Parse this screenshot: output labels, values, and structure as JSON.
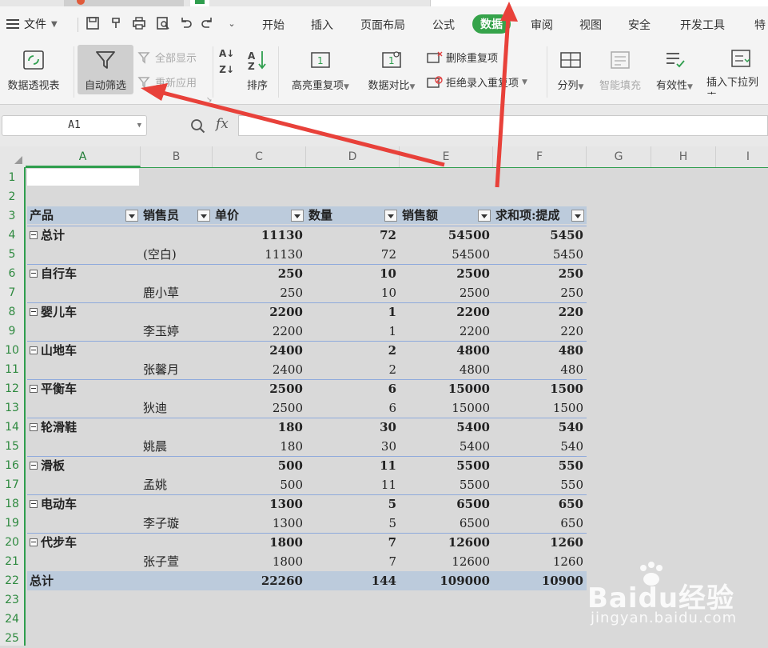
{
  "menu": {
    "file_label": "文件",
    "tabs": [
      "开始",
      "插入",
      "页面布局",
      "公式",
      "数据",
      "审阅",
      "视图",
      "安全",
      "开发工具",
      "特"
    ],
    "active_tab": "数据"
  },
  "ribbon": {
    "pivot": "数据透视表",
    "autofilter": "自动筛选",
    "show_all": "全部显示",
    "reapply": "重新应用",
    "sort": "排序",
    "highlight_dup": "高亮重复项",
    "compare": "数据对比",
    "remove_dup": "删除重复项",
    "reject_dup": "拒绝录入重复项",
    "split": "分列",
    "smart_fill": "智能填充",
    "validity": "有效性",
    "insert_dropdown": "插入下拉列表"
  },
  "formula_bar": {
    "name_box": "A1",
    "fx": "fx",
    "formula": ""
  },
  "columns": [
    "A",
    "B",
    "C",
    "D",
    "E",
    "F",
    "G",
    "H",
    "I"
  ],
  "rows": [
    "1",
    "2",
    "3",
    "4",
    "5",
    "6",
    "7",
    "8",
    "9",
    "10",
    "11",
    "12",
    "13",
    "14",
    "15",
    "16",
    "17",
    "18",
    "19",
    "20",
    "21",
    "22",
    "23",
    "24",
    "25"
  ],
  "pivot": {
    "headers": [
      "产品",
      "销售员",
      "单价",
      "数量",
      "销售额",
      "求和项:提成"
    ],
    "rows": [
      {
        "product": "总计",
        "seller": "",
        "price": "11130",
        "qty": "72",
        "sales": "54500",
        "comm": "5450",
        "group": true
      },
      {
        "product": "",
        "seller": "(空白)",
        "price": "11130",
        "qty": "72",
        "sales": "54500",
        "comm": "5450",
        "group": false
      },
      {
        "product": "自行车",
        "seller": "",
        "price": "250",
        "qty": "10",
        "sales": "2500",
        "comm": "250",
        "group": true
      },
      {
        "product": "",
        "seller": "鹿小草",
        "price": "250",
        "qty": "10",
        "sales": "2500",
        "comm": "250",
        "group": false
      },
      {
        "product": "婴儿车",
        "seller": "",
        "price": "2200",
        "qty": "1",
        "sales": "2200",
        "comm": "220",
        "group": true
      },
      {
        "product": "",
        "seller": "李玉婷",
        "price": "2200",
        "qty": "1",
        "sales": "2200",
        "comm": "220",
        "group": false
      },
      {
        "product": "山地车",
        "seller": "",
        "price": "2400",
        "qty": "2",
        "sales": "4800",
        "comm": "480",
        "group": true
      },
      {
        "product": "",
        "seller": "张馨月",
        "price": "2400",
        "qty": "2",
        "sales": "4800",
        "comm": "480",
        "group": false
      },
      {
        "product": "平衡车",
        "seller": "",
        "price": "2500",
        "qty": "6",
        "sales": "15000",
        "comm": "1500",
        "group": true
      },
      {
        "product": "",
        "seller": "狄迪",
        "price": "2500",
        "qty": "6",
        "sales": "15000",
        "comm": "1500",
        "group": false
      },
      {
        "product": "轮滑鞋",
        "seller": "",
        "price": "180",
        "qty": "30",
        "sales": "5400",
        "comm": "540",
        "group": true
      },
      {
        "product": "",
        "seller": "姚晨",
        "price": "180",
        "qty": "30",
        "sales": "5400",
        "comm": "540",
        "group": false
      },
      {
        "product": "滑板",
        "seller": "",
        "price": "500",
        "qty": "11",
        "sales": "5500",
        "comm": "550",
        "group": true
      },
      {
        "product": "",
        "seller": "孟姚",
        "price": "500",
        "qty": "11",
        "sales": "5500",
        "comm": "550",
        "group": false
      },
      {
        "product": "电动车",
        "seller": "",
        "price": "1300",
        "qty": "5",
        "sales": "6500",
        "comm": "650",
        "group": true
      },
      {
        "product": "",
        "seller": "李子璇",
        "price": "1300",
        "qty": "5",
        "sales": "6500",
        "comm": "650",
        "group": false
      },
      {
        "product": "代步车",
        "seller": "",
        "price": "1800",
        "qty": "7",
        "sales": "12600",
        "comm": "1260",
        "group": true
      },
      {
        "product": "",
        "seller": "张子萱",
        "price": "1800",
        "qty": "7",
        "sales": "12600",
        "comm": "1260",
        "group": false
      }
    ],
    "total": {
      "label": "总计",
      "price": "22260",
      "qty": "144",
      "sales": "109000",
      "comm": "10900"
    }
  },
  "watermark": {
    "brand": "Baidu经验",
    "url": "jingyan.baidu.com"
  }
}
